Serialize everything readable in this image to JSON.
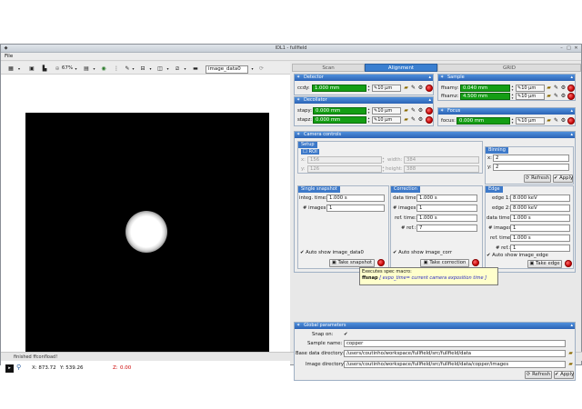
{
  "window": {
    "title": "IDL1 - fullfield"
  },
  "menu": {
    "item": "File"
  },
  "toolbar": {
    "zoom": "67%",
    "image_combo": "image_data0"
  },
  "coords": {
    "x": "X: 873.72",
    "y": "Y: 539.26",
    "z_label": "Z:",
    "z": "0.00"
  },
  "status": "finished ffconfload!",
  "tabs": [
    "Scan",
    "Alignment",
    "GRID"
  ],
  "detector": {
    "title": "Detector",
    "row_label": "ccdy:",
    "value": "1.000 mm",
    "step": "10 μm"
  },
  "sample": {
    "title": "Sample",
    "rows": [
      {
        "label": "ffsamy:",
        "value": "0.040 mm",
        "step": "10 μm"
      },
      {
        "label": "ffsamz:",
        "value": "4.500 mm",
        "step": "10 μm"
      }
    ]
  },
  "decollator": {
    "title": "Decollator",
    "rows": [
      {
        "label": "stapy:",
        "value": "0.000 mm",
        "step": "10 μm"
      },
      {
        "label": "stapz:",
        "value": "0.000 mm",
        "step": "10 μm"
      }
    ]
  },
  "focus": {
    "title": "Focus",
    "row_label": "focus:",
    "value": "0.000 mm",
    "step": "10 μm"
  },
  "camera": {
    "title": "Camera controls",
    "setup": {
      "title": "Setup",
      "roi": "ROI",
      "x_label": "x:",
      "x": "156",
      "y_label": "y:",
      "y": "126",
      "width_label": "width:",
      "width": "384",
      "height_label": "height:",
      "height": "388"
    },
    "binning": {
      "title": "Binning",
      "x_label": "x:",
      "x": "2",
      "y_label": "y:",
      "y": "2",
      "refresh": "Refresh",
      "apply": "Apply"
    },
    "single": {
      "title": "Single snapshot",
      "integ_label": "integ. time:",
      "integ": "1.000 s",
      "images_label": "# images:",
      "images": "1",
      "auto": "Auto show image_data0",
      "btn": "Take snapshot"
    },
    "correction": {
      "title": "Correction",
      "data_time_label": "data time:",
      "data_time": "1.000 s",
      "images_label": "# images:",
      "images": "1",
      "ref_time_label": "ref. time:",
      "ref_time": "1.000 s",
      "ref_label": "# ref.:",
      "ref": "7",
      "auto": "Auto show image_corr",
      "btn": "Take correction"
    },
    "edge": {
      "title": "Edge",
      "edge1_label": "edge 1:",
      "edge1": "8.000 keV",
      "edge2_label": "edge 2:",
      "edge2": "8.000 keV",
      "data_time_label": "data time:",
      "data_time": "1.000 s",
      "images_label": "# images:",
      "images": "1",
      "ref_time_label": "ref. time:",
      "ref_time": "1.000 s",
      "ref_label": "# ref.:",
      "ref": "1",
      "auto": "Auto show image_edge",
      "btn": "Take edge"
    }
  },
  "global": {
    "title": "Global parameters",
    "snap_label": "Snap on:",
    "sample_label": "Sample name:",
    "sample": "copper",
    "base_label": "Base data directory:",
    "base": "/users/coutinho/workspace/fullfield/src/fullfield/data",
    "image_label": "Image directory:",
    "image": "/users/coutinho/workspace/fullfield/src/fullfield/data/copper/images",
    "refresh": "Refresh",
    "apply": "Apply"
  },
  "tooltip": {
    "line1": "Executes spec macro:",
    "cmd": "ffsnap",
    "args": "[ expo_time= current camera exposition time ]"
  }
}
